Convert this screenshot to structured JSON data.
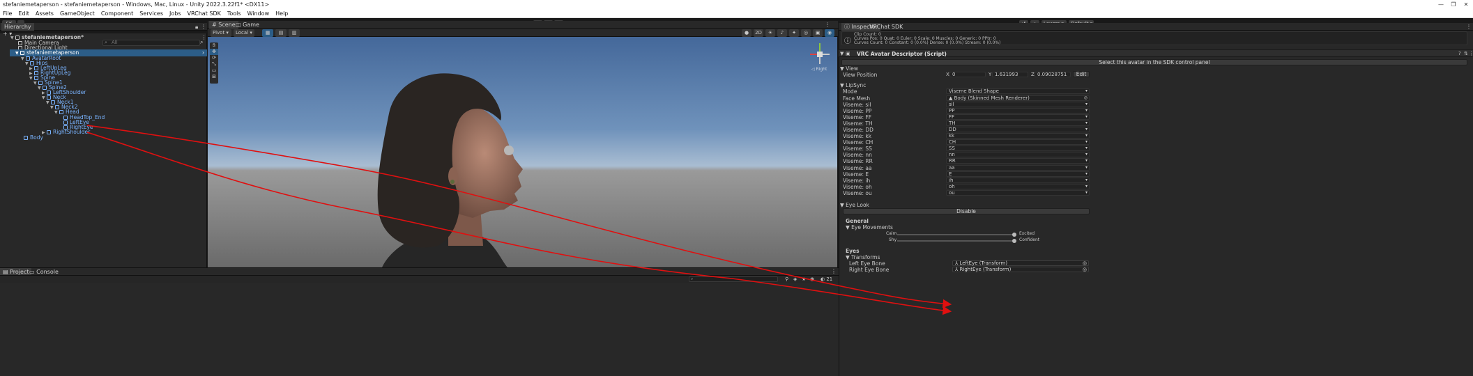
{
  "window": {
    "title": "stefaniemetaperson - stefaniemetaperson - Windows, Mac, Linux - Unity 2022.3.22f1* <DX11>"
  },
  "menu": [
    "File",
    "Edit",
    "Assets",
    "GameObject",
    "Component",
    "Services",
    "Jobs",
    "VRChat SDK",
    "Tools",
    "Window",
    "Help"
  ],
  "toolbar": {
    "account": "SK",
    "layers": "Layers",
    "layout": "Default"
  },
  "hierarchy": {
    "tab": "Hierarchy",
    "search_placeholder": "All",
    "scene_name": "stefaniemetaperson*",
    "rows": [
      {
        "label": "Main Camera"
      },
      {
        "label": "Directional Light"
      },
      {
        "label": "stefaniemetaperson"
      },
      {
        "label": "AvatarRoot"
      },
      {
        "label": "Hips"
      },
      {
        "label": "LeftUpLeg"
      },
      {
        "label": "RightUpLeg"
      },
      {
        "label": "Spine"
      },
      {
        "label": "Spine1"
      },
      {
        "label": "Spine2"
      },
      {
        "label": "LeftShoulder"
      },
      {
        "label": "Neck"
      },
      {
        "label": "Neck1"
      },
      {
        "label": "Neck2"
      },
      {
        "label": "Head"
      },
      {
        "label": "HeadTop_End"
      },
      {
        "label": "LeftEye"
      },
      {
        "label": "RightEye"
      },
      {
        "label": "RightShoulder"
      },
      {
        "label": "Body"
      }
    ]
  },
  "scene": {
    "tabs": [
      "Scene",
      "Game"
    ],
    "pivot": "Pivot",
    "space": "Local",
    "mode_2d": "2D",
    "gizmo_label": "Right"
  },
  "bottom_tabs": [
    "Project",
    "Console"
  ],
  "bottom_count": "21",
  "inspector": {
    "tabs": [
      "Inspector",
      "VRChat SDK"
    ],
    "info": [
      "Clip Count: 0",
      "Curves Pos: 0 Quat: 0 Euler: 0 Scale: 0 Muscles: 0 Generic: 0 PPtr: 0",
      "Curves Count: 0 Constant: 0 (0.0%) Dense: 0 (0.0%) Stream: 0 (0.0%)"
    ],
    "component_title": "VRC Avatar Descriptor (Script)",
    "select_button": "Select this avatar in the SDK control panel",
    "view_section": "View",
    "view_position_label": "View Position",
    "view_x_label": "X",
    "view_x": "0",
    "view_y_label": "Y",
    "view_y": "1.631993",
    "view_z_label": "Z",
    "view_z": "0.09028751",
    "edit_button": "Edit",
    "lipsync_section": "LipSync",
    "mode_label": "Mode",
    "mode_value": "Viseme Blend Shape",
    "face_mesh_label": "Face Mesh",
    "face_mesh_value": "Body (Skinned Mesh Renderer)",
    "visemes": [
      {
        "label": "Viseme: sil",
        "value": "sil"
      },
      {
        "label": "Viseme: PP",
        "value": "PP"
      },
      {
        "label": "Viseme: FF",
        "value": "FF"
      },
      {
        "label": "Viseme: TH",
        "value": "TH"
      },
      {
        "label": "Viseme: DD",
        "value": "DD"
      },
      {
        "label": "Viseme: kk",
        "value": "kk"
      },
      {
        "label": "Viseme: CH",
        "value": "CH"
      },
      {
        "label": "Viseme: SS",
        "value": "SS"
      },
      {
        "label": "Viseme: nn",
        "value": "nn"
      },
      {
        "label": "Viseme: RR",
        "value": "RR"
      },
      {
        "label": "Viseme: aa",
        "value": "aa"
      },
      {
        "label": "Viseme: E",
        "value": "E"
      },
      {
        "label": "Viseme: ih",
        "value": "ih"
      },
      {
        "label": "Viseme: oh",
        "value": "oh"
      },
      {
        "label": "Viseme: ou",
        "value": "ou"
      }
    ],
    "eyelook_section": "Eye Look",
    "disable_button": "Disable",
    "general_label": "General",
    "eye_movements_label": "Eye Movements",
    "calm_label": "Calm",
    "excited_label": "Excited",
    "shy_label": "Shy",
    "confident_label": "Confident",
    "calm_excited_level": 1.0,
    "shy_confident_level": 1.0,
    "eyes_label": "Eyes",
    "transforms_label": "Transforms",
    "left_eye_label": "Left Eye Bone",
    "left_eye_value": "LeftEye (Transform)",
    "right_eye_label": "Right Eye Bone",
    "right_eye_value": "RightEye (Transform)"
  },
  "colors": {
    "accent_blue": "#7ab4ff",
    "selection": "#2c5d87",
    "annotation_red": "#e01010"
  }
}
